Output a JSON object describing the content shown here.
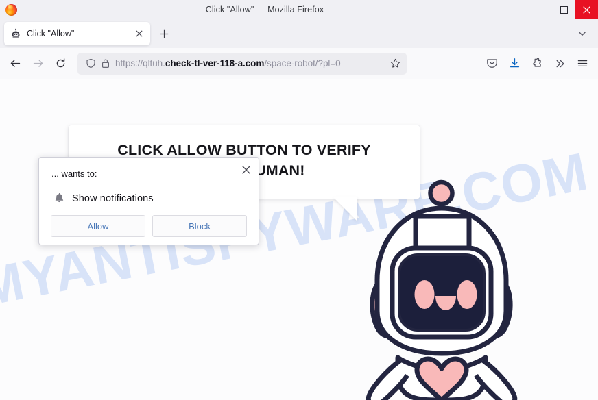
{
  "window": {
    "title": "Click \"Allow\" — Mozilla Firefox",
    "logo_icon": "firefox-logo",
    "minimize_icon": "minimize-icon",
    "maximize_icon": "maximize-icon",
    "close_icon": "close-icon"
  },
  "tabbar": {
    "tabs": [
      {
        "label": "Click \"Allow\"",
        "favicon": "robot-favicon",
        "close_icon": "tab-close-icon",
        "active": true
      }
    ],
    "new_tab_icon": "plus-icon",
    "list_all_tabs_icon": "chevron-down-icon"
  },
  "toolbar": {
    "back_icon": "arrow-left-icon",
    "forward_icon": "arrow-right-icon",
    "reload_icon": "reload-icon",
    "shield_icon": "shield-icon",
    "lock_icon": "lock-icon",
    "bookmark_icon": "star-icon",
    "url": {
      "scheme_host_prefix": "https://qltuh.",
      "domain": "check-tl-ver-118-a.com",
      "path": "/space-robot/?pl=0",
      "full": "https://qltuh.check-tl-ver-118-a.com/space-robot/?pl=0"
    },
    "icons": [
      {
        "name": "pocket-icon"
      },
      {
        "name": "downloads-icon"
      },
      {
        "name": "extensions-puzzle-icon"
      },
      {
        "name": "overflow-chevrons-icon"
      },
      {
        "name": "app-menu-icon"
      }
    ]
  },
  "page": {
    "watermark": "MYANTISPYWARE.COM",
    "bubble": {
      "line1": "CLICK ALLOW BUTTON TO VERIFY",
      "line2": "YOU'RE HUMAN!"
    },
    "robot": {
      "name": "space-robot-mascot",
      "body_color": "#ffffff",
      "outline_color": "#232540",
      "accent_color": "#f9b9b9",
      "face_color": "#1c1f3b"
    }
  },
  "permission_popup": {
    "origin_label": "... wants to:",
    "request_label": "Show notifications",
    "bell_icon": "bell-icon",
    "close_icon": "popup-close-icon",
    "allow_label": "Allow",
    "block_label": "Block",
    "link_color": "#4a78b8"
  }
}
